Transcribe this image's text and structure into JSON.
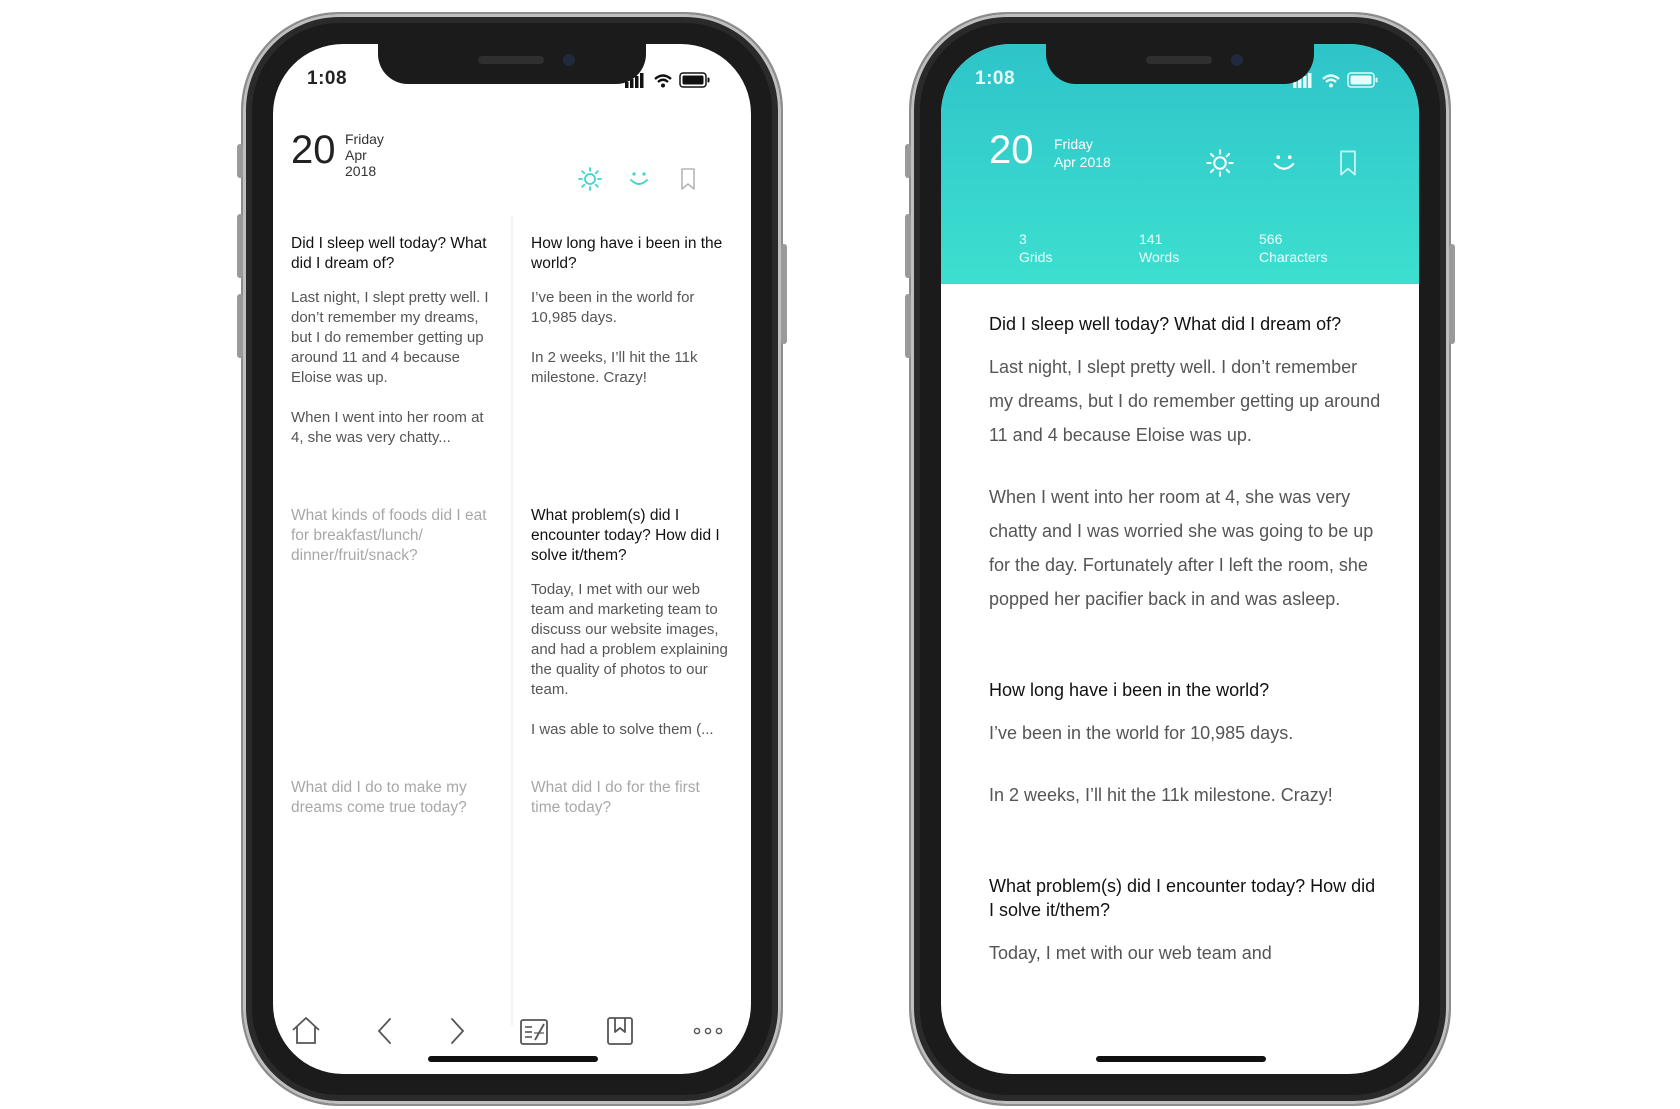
{
  "status": {
    "time": "1:08"
  },
  "date": {
    "day": "20",
    "weekday": "Friday",
    "month_year": "Apr 2018"
  },
  "left": {
    "header_icons": [
      "sun-icon",
      "smile-icon",
      "bookmark-icon"
    ],
    "cells": [
      {
        "question": "Did I sleep well today? What did I dream of?",
        "answer": "Last night, I slept pretty well. I don’t remember my dreams, but I do remember getting up around 11 and 4 because Eloise was up.",
        "answer2": "When I went into her room at 4, she was very chatty..."
      },
      {
        "question": "How long have i been in the world?",
        "answer": "I’ve been in the world for 10,985 days.",
        "answer2": "In 2 weeks, I’ll hit the 11k milestone. Crazy!"
      },
      {
        "question": "What kinds of foods did I eat for breakfast/lunch/ dinner/fruit/snack?"
      },
      {
        "question": "What problem(s) did I encounter today? How did I solve it/them?",
        "answer": "Today, I met with our web team and marketing team to discuss our website images, and had a problem explaining the quality of photos to our team.",
        "answer2": "I was able to solve them (..."
      },
      {
        "question": "What did I do to make my dreams come true today?"
      },
      {
        "question": "What did I do for the first time today?"
      }
    ],
    "tabbar": [
      "home-icon",
      "back-arrow-icon",
      "forward-arrow-icon",
      "grid-edit-icon",
      "bookmark-book-icon",
      "more-icon"
    ]
  },
  "right": {
    "stats": [
      {
        "value": "3",
        "label": "Grids"
      },
      {
        "value": "141",
        "label": "Words"
      },
      {
        "value": "566",
        "label": "Characters"
      }
    ],
    "entries": [
      {
        "question": "Did I sleep well today? What did I dream of?",
        "paragraphs": [
          "Last night, I slept pretty well. I don’t remember my dreams, but I do remember getting up around 11 and 4 because Eloise was up.",
          "When I went into her room at 4, she was very chatty and I was worried she was going to be up for the day. Fortunately after I left the room, she popped her pacifier back in and was asleep."
        ]
      },
      {
        "question": "How long have i been in the world?",
        "paragraphs": [
          "I’ve been in the world for 10,985 days.",
          "In 2 weeks, I’ll hit the 11k milestone. Crazy!"
        ]
      },
      {
        "question": "What problem(s) did I encounter today? How did I solve it/them?",
        "paragraphs": [
          "Today, I met with our web team and"
        ]
      }
    ]
  },
  "colors": {
    "accent": "#3cd6cf",
    "teal_top": "#2ec4c9",
    "teal_bottom": "#3ddfd0"
  }
}
